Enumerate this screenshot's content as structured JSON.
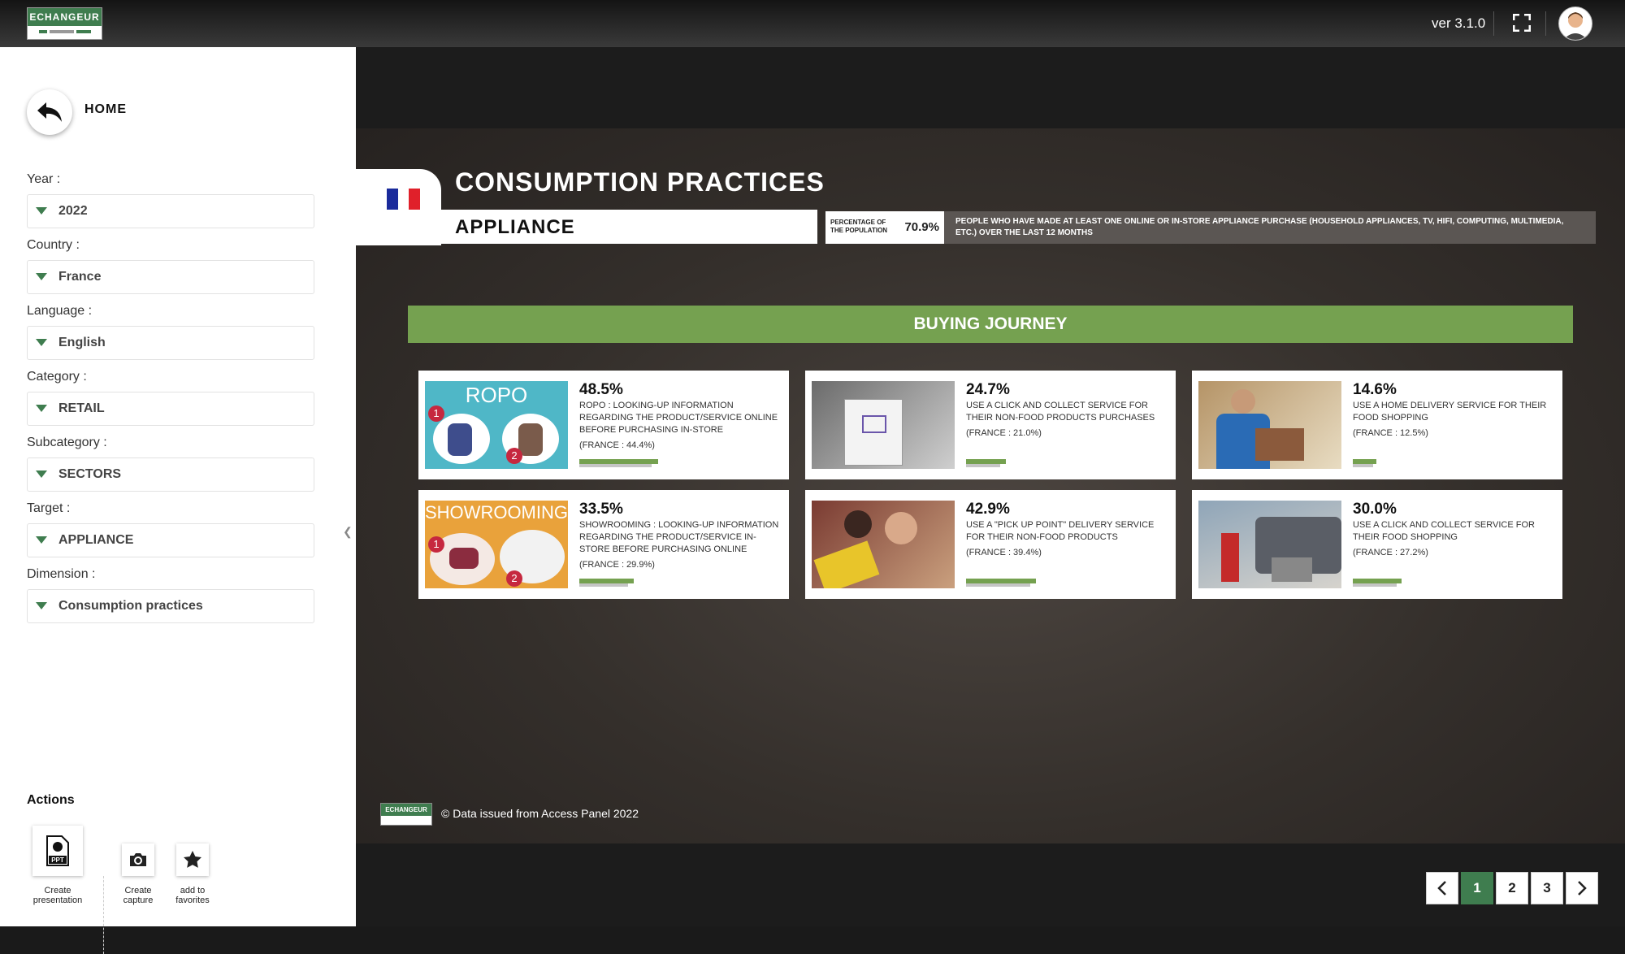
{
  "topbar": {
    "logo_text": "ECHANGEUR",
    "version": "ver 3.1.0",
    "icons": {
      "fullscreen": "fullscreen-icon",
      "user": "user-avatar-icon"
    }
  },
  "sidebar": {
    "home_label": "HOME",
    "filters": [
      {
        "label": "Year :",
        "value": "2022"
      },
      {
        "label": "Country :",
        "value": "France"
      },
      {
        "label": "Language :",
        "value": "English"
      },
      {
        "label": "Category :",
        "value": "RETAIL"
      },
      {
        "label": "Subcategory :",
        "value": "SECTORS"
      },
      {
        "label": "Target :",
        "value": "APPLIANCE"
      },
      {
        "label": "Dimension :",
        "value": "Consumption practices"
      }
    ],
    "actions_title": "Actions",
    "actions": [
      {
        "label_line1": "Create",
        "label_line2": "presentation",
        "icon": "ppt-icon",
        "icon_text": "PPT"
      },
      {
        "label_line1": "Create",
        "label_line2": "capture",
        "icon": "camera-icon"
      },
      {
        "label_line1": "add to",
        "label_line2": "favorites",
        "icon": "star-icon"
      }
    ]
  },
  "slide": {
    "title": "CONSUMPTION PRACTICES",
    "subtitle": "APPLIANCE",
    "population_label_line1": "PERCENTAGE OF",
    "population_label_line2": "THE POPULATION",
    "population_value": "70.9%",
    "population_description": "PEOPLE WHO HAVE MADE AT LEAST ONE ONLINE OR IN-STORE APPLIANCE PURCHASE (HOUSEHOLD APPLIANCES, TV, HIFI, COMPUTING, MULTIMEDIA, ETC.) OVER THE LAST 12 MONTHS",
    "section_title": "BUYING JOURNEY",
    "cards": [
      {
        "pct": "48.5%",
        "desc": "ROPO : LOOKING-UP INFORMATION REGARDING THE PRODUCT/SERVICE ONLINE BEFORE PURCHASING IN-STORE",
        "ref": "(FRANCE : 44.4%)",
        "image_label": "ROPO",
        "value": 48.5,
        "ref_value": 44.4
      },
      {
        "pct": "24.7%",
        "desc": "USE A CLICK AND COLLECT SERVICE FOR THEIR NON-FOOD PRODUCTS PURCHASES",
        "ref": "(FRANCE : 21.0%)",
        "value": 24.7,
        "ref_value": 21.0
      },
      {
        "pct": "14.6%",
        "desc": "USE A HOME DELIVERY SERVICE FOR THEIR FOOD SHOPPING",
        "ref": "(FRANCE : 12.5%)",
        "value": 14.6,
        "ref_value": 12.5
      },
      {
        "pct": "33.5%",
        "desc": "SHOWROOMING : LOOKING-UP INFORMATION REGARDING THE PRODUCT/SERVICE IN-STORE BEFORE PURCHASING ONLINE",
        "ref": "(FRANCE : 29.9%)",
        "image_label": "SHOWROOMING",
        "value": 33.5,
        "ref_value": 29.9
      },
      {
        "pct": "42.9%",
        "desc": "USE A \"PICK UP POINT\" DELIVERY SERVICE FOR THEIR NON-FOOD PRODUCTS",
        "ref": "(FRANCE : 39.4%)",
        "value": 42.9,
        "ref_value": 39.4
      },
      {
        "pct": "30.0%",
        "desc": "USE A CLICK AND COLLECT SERVICE FOR THEIR FOOD SHOPPING",
        "ref": "(FRANCE : 27.2%)",
        "value": 30.0,
        "ref_value": 27.2
      }
    ],
    "footer": "© Data issued from Access Panel 2022"
  },
  "pagination": {
    "prev": "‹",
    "pages": [
      "1",
      "2",
      "3"
    ],
    "active": "1",
    "next": "›"
  },
  "colors": {
    "accent": "#3f7d4f",
    "bar_green": "#75a150",
    "flag_blue": "#1a2a9b",
    "flag_red": "#e0202a"
  }
}
